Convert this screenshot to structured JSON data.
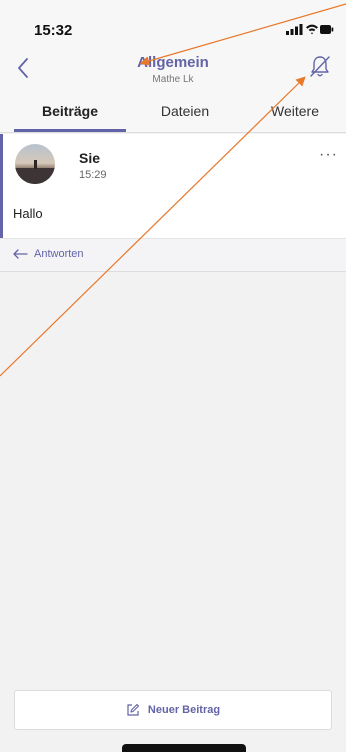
{
  "status_bar": {
    "time": "15:32",
    "signal_icon": "signal-bars-icon",
    "wifi_icon": "wifi-icon",
    "battery_icon": "battery-icon"
  },
  "header": {
    "title": "Allgemein",
    "subtitle": "Mathe Lk",
    "back_icon": "chevron-left-icon",
    "bell_icon": "bell-off-icon"
  },
  "tabs": [
    {
      "label": "Beiträge",
      "active": true
    },
    {
      "label": "Dateien",
      "active": false
    },
    {
      "label": "Weitere",
      "active": false
    }
  ],
  "post": {
    "author": "Sie",
    "time": "15:29",
    "message": "Hallo",
    "more_icon": "ellipsis-icon",
    "more_label": "···"
  },
  "reply": {
    "label": "Antworten",
    "icon": "reply-arrow-icon"
  },
  "compose": {
    "label": "Neuer Beitrag",
    "icon": "compose-icon"
  },
  "colors": {
    "accent": "#6264a7",
    "annotation": "#e8782a"
  }
}
